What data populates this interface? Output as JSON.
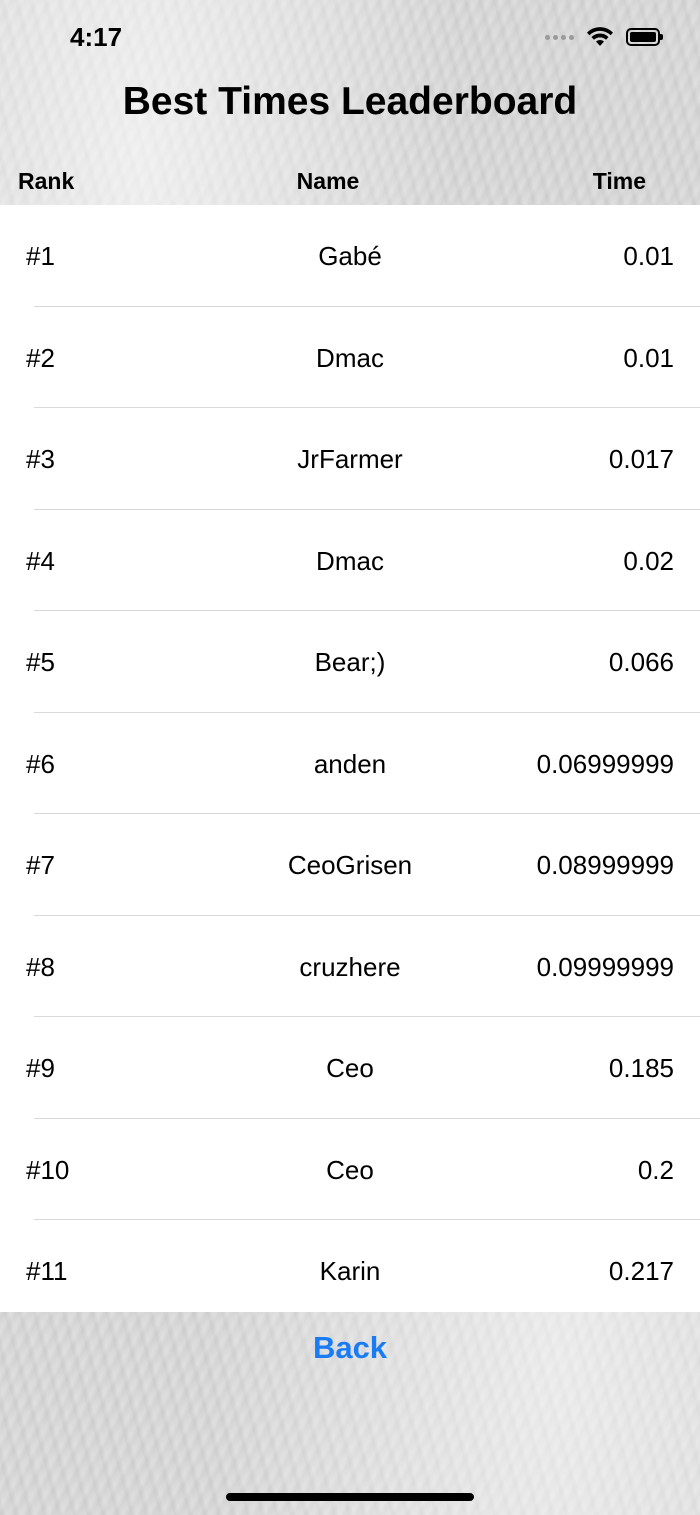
{
  "status_bar": {
    "time": "4:17"
  },
  "title": "Best Times Leaderboard",
  "columns": {
    "rank": "Rank",
    "name": "Name",
    "time": "Time"
  },
  "rows": [
    {
      "rank": "#1",
      "name": "Gabé",
      "time": "0.01"
    },
    {
      "rank": "#2",
      "name": "Dmac",
      "time": "0.01"
    },
    {
      "rank": "#3",
      "name": "JrFarmer",
      "time": "0.017"
    },
    {
      "rank": "#4",
      "name": "Dmac",
      "time": "0.02"
    },
    {
      "rank": "#5",
      "name": "Bear;)",
      "time": "0.066"
    },
    {
      "rank": "#6",
      "name": "anden",
      "time": "0.06999999"
    },
    {
      "rank": "#7",
      "name": "CeoGrisen",
      "time": "0.08999999"
    },
    {
      "rank": "#8",
      "name": "cruzhere",
      "time": "0.09999999"
    },
    {
      "rank": "#9",
      "name": "Ceo",
      "time": "0.185"
    },
    {
      "rank": "#10",
      "name": "Ceo",
      "time": "0.2"
    },
    {
      "rank": "#11",
      "name": "Karin",
      "time": "0.217"
    }
  ],
  "back_label": "Back",
  "colors": {
    "accent": "#1a7cf5",
    "text": "#000000",
    "table_bg": "#ffffff"
  }
}
